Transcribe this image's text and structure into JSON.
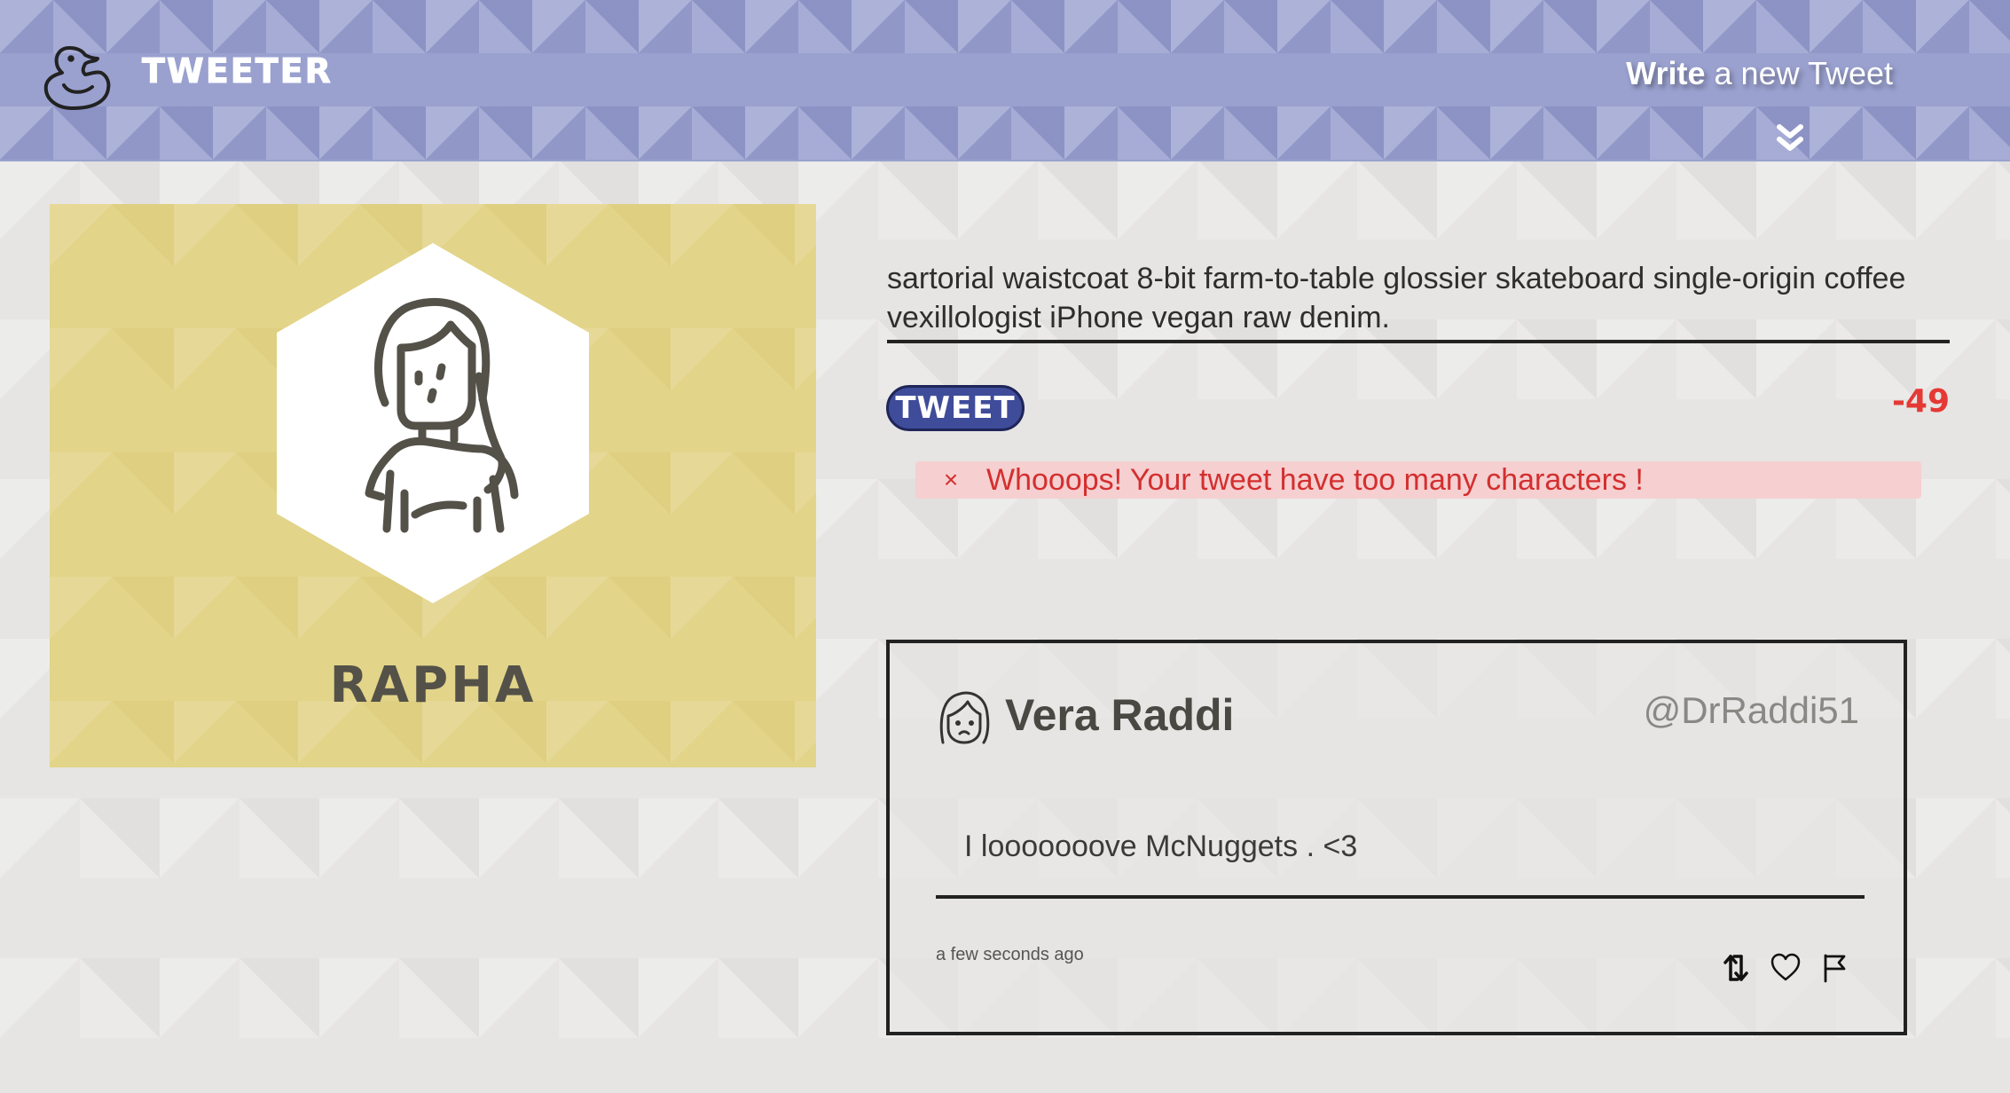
{
  "nav": {
    "brand": "TWEETER",
    "compose_strong": "Write",
    "compose_rest": " a new Tweet",
    "logo_icon": "duck-icon",
    "toggle_icon": "double-chevron-down-icon"
  },
  "profile": {
    "name": "RAPHA",
    "avatar_icon": "woman-avatar-icon"
  },
  "compose": {
    "text_partial_line": "sartorial waistcoat 8-bit farm-to-table glossier skateboard single-origin coffee",
    "text_last_line": "vexillologist iPhone vegan raw denim.",
    "button_label": "TWEET",
    "counter": "-49",
    "error_close": "×",
    "error_message": "Whooops! Your tweet have too many characters !"
  },
  "tweet": {
    "author": "Vera Raddi",
    "handle": "@DrRaddi51",
    "body": "I looooooove McNuggets . <3",
    "time": "a few seconds ago",
    "avatar_icon": "avatar-icon",
    "actions": [
      "retweet-icon",
      "heart-icon",
      "flag-icon"
    ]
  },
  "colors": {
    "nav_bg": "#9aa1cf",
    "profile_bg": "#e2d489",
    "button_bg": "#3f4c9a",
    "error_text": "#d32f2f",
    "error_bg": "#f6cfd0",
    "counter": "#e53935"
  }
}
